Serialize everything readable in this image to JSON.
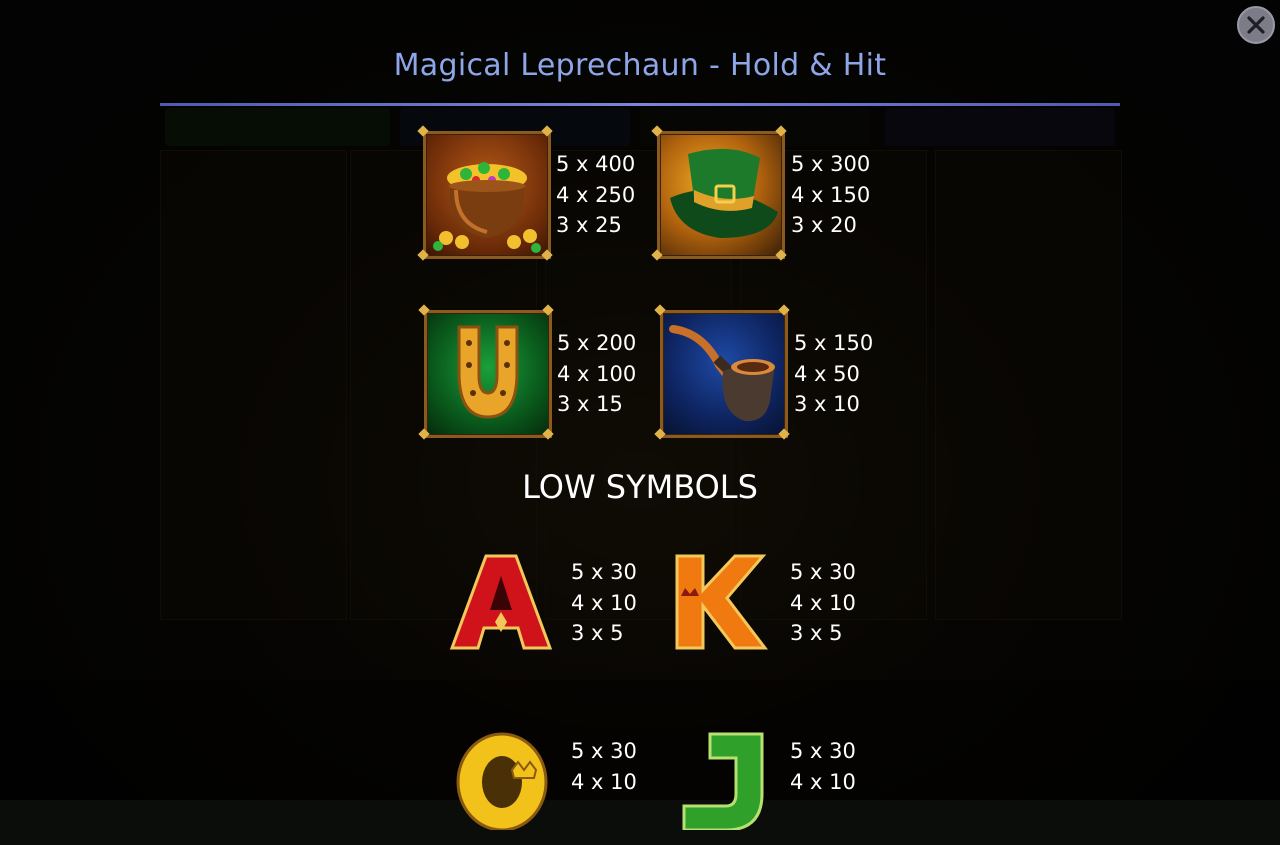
{
  "title": "Magical Leprechaun - Hold & Hit",
  "close_icon": "close-icon",
  "high_symbols": [
    {
      "name": "pot-of-gold",
      "pays": [
        "5 x 400",
        "4 x 250",
        "3 x 25"
      ]
    },
    {
      "name": "leprechaun-hat",
      "pays": [
        "5 x 300",
        "4 x 150",
        "3 x 20"
      ]
    },
    {
      "name": "horseshoe",
      "pays": [
        "5 x 200",
        "4 x 100",
        "3 x 15"
      ]
    },
    {
      "name": "pipe",
      "pays": [
        "5 x 150",
        "4 x 50",
        "3 x 10"
      ]
    }
  ],
  "low_heading": "LOW SYMBOLS",
  "low_symbols": [
    {
      "letter": "A",
      "pays": [
        "5 x 30",
        "4 x 10",
        "3 x 5"
      ]
    },
    {
      "letter": "K",
      "pays": [
        "5 x 30",
        "4 x 10",
        "3 x 5"
      ]
    },
    {
      "letter": "Q",
      "pays": [
        "5 x 30",
        "4 x 10"
      ]
    },
    {
      "letter": "J",
      "pays": [
        "5 x 30",
        "4 x 10"
      ]
    }
  ],
  "colors": {
    "title": "#8ea6e8",
    "divider": "#6d7bd0",
    "letter_a": "#d0121a",
    "letter_k": "#f07a10",
    "letter_q": "#f3c21a",
    "letter_j": "#2fa12a"
  }
}
